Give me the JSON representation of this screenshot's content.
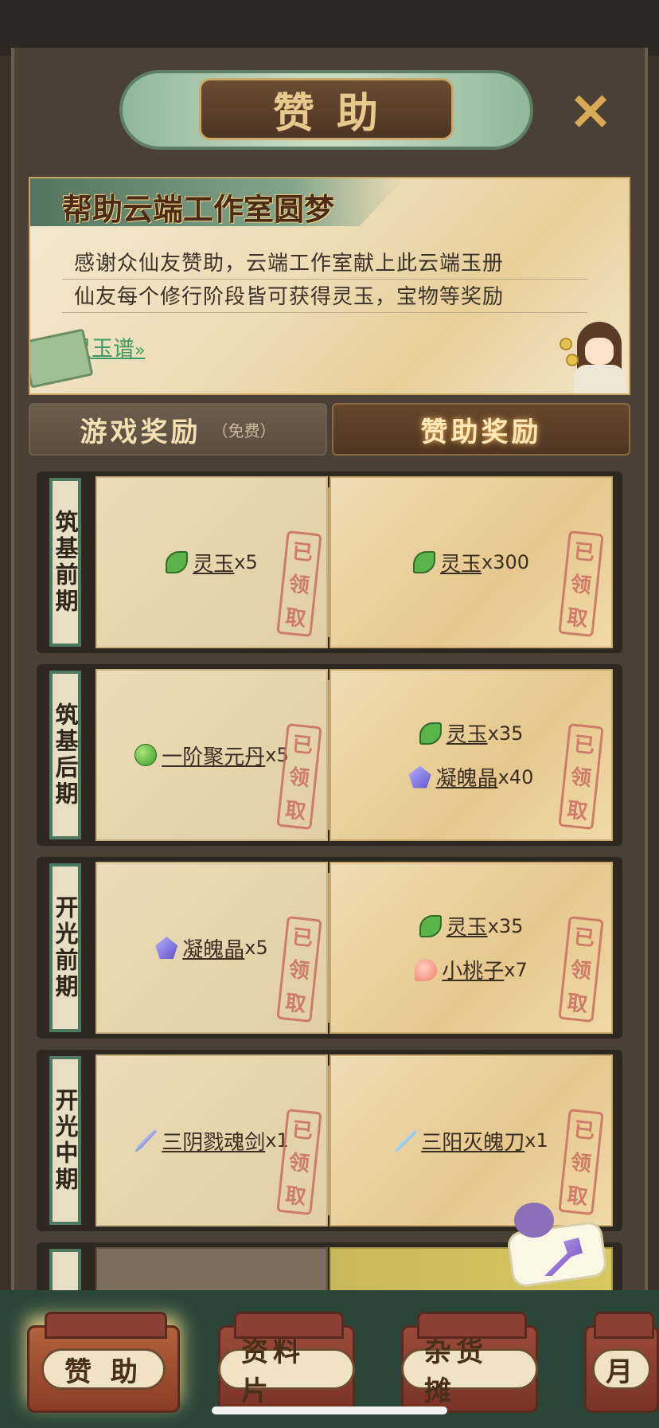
{
  "header": {
    "title": "赞助",
    "close_icon": "close-icon"
  },
  "banner": {
    "title": "帮助云端工作室圆梦",
    "line1": "感谢众仙友赞助，云端工作室献上此云端玉册",
    "line2": "仙友每个修行阶段皆可获得灵玉，宝物等奖励",
    "link": "灵玉谱"
  },
  "tabs": {
    "free": {
      "label": "游戏奖励",
      "sub": "（免费）"
    },
    "sponsor": {
      "label": "赞助奖励"
    }
  },
  "stamp": [
    "已",
    "领",
    "取"
  ],
  "rows": [
    {
      "stage": "筑基前期",
      "free": [
        {
          "icon": "jade-icon",
          "name": "灵玉",
          "qty": "x5"
        }
      ],
      "paid": [
        {
          "icon": "jade-icon",
          "name": "灵玉",
          "qty": "x300"
        }
      ]
    },
    {
      "stage": "筑基后期",
      "free": [
        {
          "icon": "pill-icon",
          "name": "一阶聚元丹",
          "qty": "x5"
        }
      ],
      "paid": [
        {
          "icon": "jade-icon",
          "name": "灵玉",
          "qty": "x35"
        },
        {
          "icon": "crystal-icon",
          "name": "凝魄晶",
          "qty": "x40"
        }
      ]
    },
    {
      "stage": "开光前期",
      "free": [
        {
          "icon": "crystal-icon",
          "name": "凝魄晶",
          "qty": "x5"
        }
      ],
      "paid": [
        {
          "icon": "jade-icon",
          "name": "灵玉",
          "qty": "x35"
        },
        {
          "icon": "peach-icon",
          "name": "小桃子",
          "qty": "x7"
        }
      ]
    },
    {
      "stage": "开光中期",
      "free": [
        {
          "icon": "sword-icon",
          "name": "三阴戮魂剑",
          "qty": "x1"
        }
      ],
      "paid": [
        {
          "icon": "blade-icon",
          "name": "三阳灭魄刀",
          "qty": "x1"
        }
      ]
    }
  ],
  "bottom_nav": [
    {
      "label": "赞 助",
      "active": true
    },
    {
      "label": "资料片",
      "active": false
    },
    {
      "label": "杂货摊",
      "active": false
    },
    {
      "label": "月",
      "active": false
    }
  ]
}
